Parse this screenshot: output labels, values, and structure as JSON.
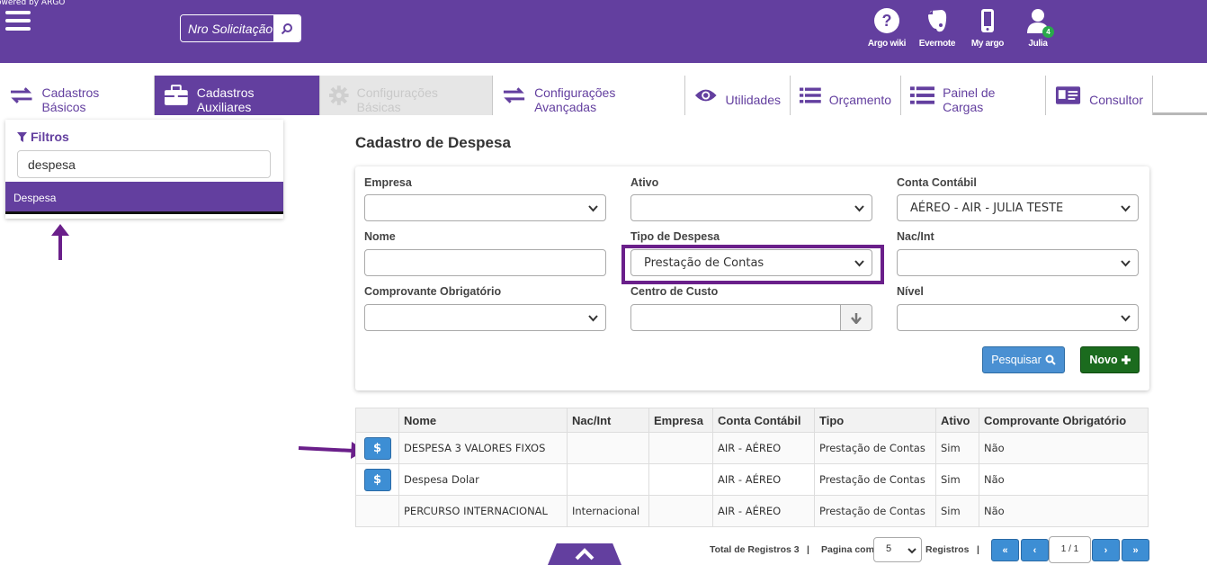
{
  "topbar": {
    "powered": "owered by ARGO",
    "search_placeholder": "Nro Solicitação",
    "icons": [
      {
        "label": "Argo wiki",
        "icon": "question-circle-icon"
      },
      {
        "label": "Evernote",
        "icon": "evernote-icon"
      },
      {
        "label": "My argo",
        "icon": "mobile-phone-icon"
      },
      {
        "label": "Julia",
        "icon": "user-icon",
        "badge": "4"
      }
    ]
  },
  "tabs": [
    {
      "label": "Cadastros Básicos",
      "state": "normal",
      "icon": "exchange-icon"
    },
    {
      "label": "Cadastros Auxiliares",
      "state": "active",
      "icon": "briefcase-icon"
    },
    {
      "label": "Configurações Básicas",
      "state": "disabled",
      "icon": "gear-icon"
    },
    {
      "label": "Configurações Avançadas",
      "state": "normal",
      "icon": "exchange-icon"
    },
    {
      "label": "Utilidades",
      "state": "normal",
      "icon": "eye-icon"
    },
    {
      "label": "Orçamento",
      "state": "normal",
      "icon": "list-icon"
    },
    {
      "label": "Painel de Cargas",
      "state": "normal",
      "icon": "list-icon"
    },
    {
      "label": "Consultor",
      "state": "normal",
      "icon": "id-card-icon"
    }
  ],
  "filters": {
    "heading": "Filtros",
    "value": "despesa",
    "result": "Despesa"
  },
  "page": {
    "title": "Cadastro de Despesa"
  },
  "form": {
    "empresa_label": "Empresa",
    "empresa_value": "",
    "ativo_label": "Ativo",
    "ativo_value": "",
    "conta_label": "Conta Contábil",
    "conta_value": "AÉREO - AIR - JULIA TESTE",
    "nome_label": "Nome",
    "nome_value": "",
    "tipo_label": "Tipo de Despesa",
    "tipo_value": "Prestação de Contas",
    "nacint_label": "Nac/Int",
    "nacint_value": "",
    "comprovante_label": "Comprovante Obrigatório",
    "comprovante_value": "",
    "centro_label": "Centro de Custo",
    "centro_value": "",
    "nivel_label": "Nível",
    "nivel_value": "",
    "pesquisar": "Pesquisar",
    "novo": "Novo"
  },
  "table": {
    "headers": [
      "",
      "Nome",
      "Nac/Int",
      "Empresa",
      "Conta Contábil",
      "Tipo",
      "Ativo",
      "Comprovante Obrigatório"
    ],
    "rows": [
      {
        "action": "$",
        "nome": "DESPESA 3 VALORES FIXOS",
        "nacint": "",
        "empresa": "",
        "conta": "AIR - AÉREO",
        "tipo": "Prestação de Contas",
        "ativo": "Sim",
        "comprovante": "Não"
      },
      {
        "action": "$",
        "nome": "Despesa Dolar",
        "nacint": "",
        "empresa": "",
        "conta": "AIR - AÉREO",
        "tipo": "Prestação de Contas",
        "ativo": "Sim",
        "comprovante": "Não"
      },
      {
        "action": "",
        "nome": "PERCURSO INTERNACIONAL",
        "nacint": "Internacional",
        "empresa": "",
        "conta": "AIR - AÉREO",
        "tipo": "Prestação de Contas",
        "ativo": "Sim",
        "comprovante": "Não"
      }
    ]
  },
  "pager": {
    "total_label": "Total de Registros 3",
    "sep1": "|",
    "pagina_label": "Pagina com",
    "page_size": "5",
    "registros_label": "Registros",
    "sep2": "|",
    "first": "«",
    "prev": "‹",
    "info": "1 / 1",
    "next": "›",
    "last": "»"
  },
  "colors": {
    "brand_purple": "#633f9f",
    "primary_blue": "#4a90d2",
    "success_green": "#1b6b1e",
    "annotation_purple": "#6a1f8a"
  }
}
